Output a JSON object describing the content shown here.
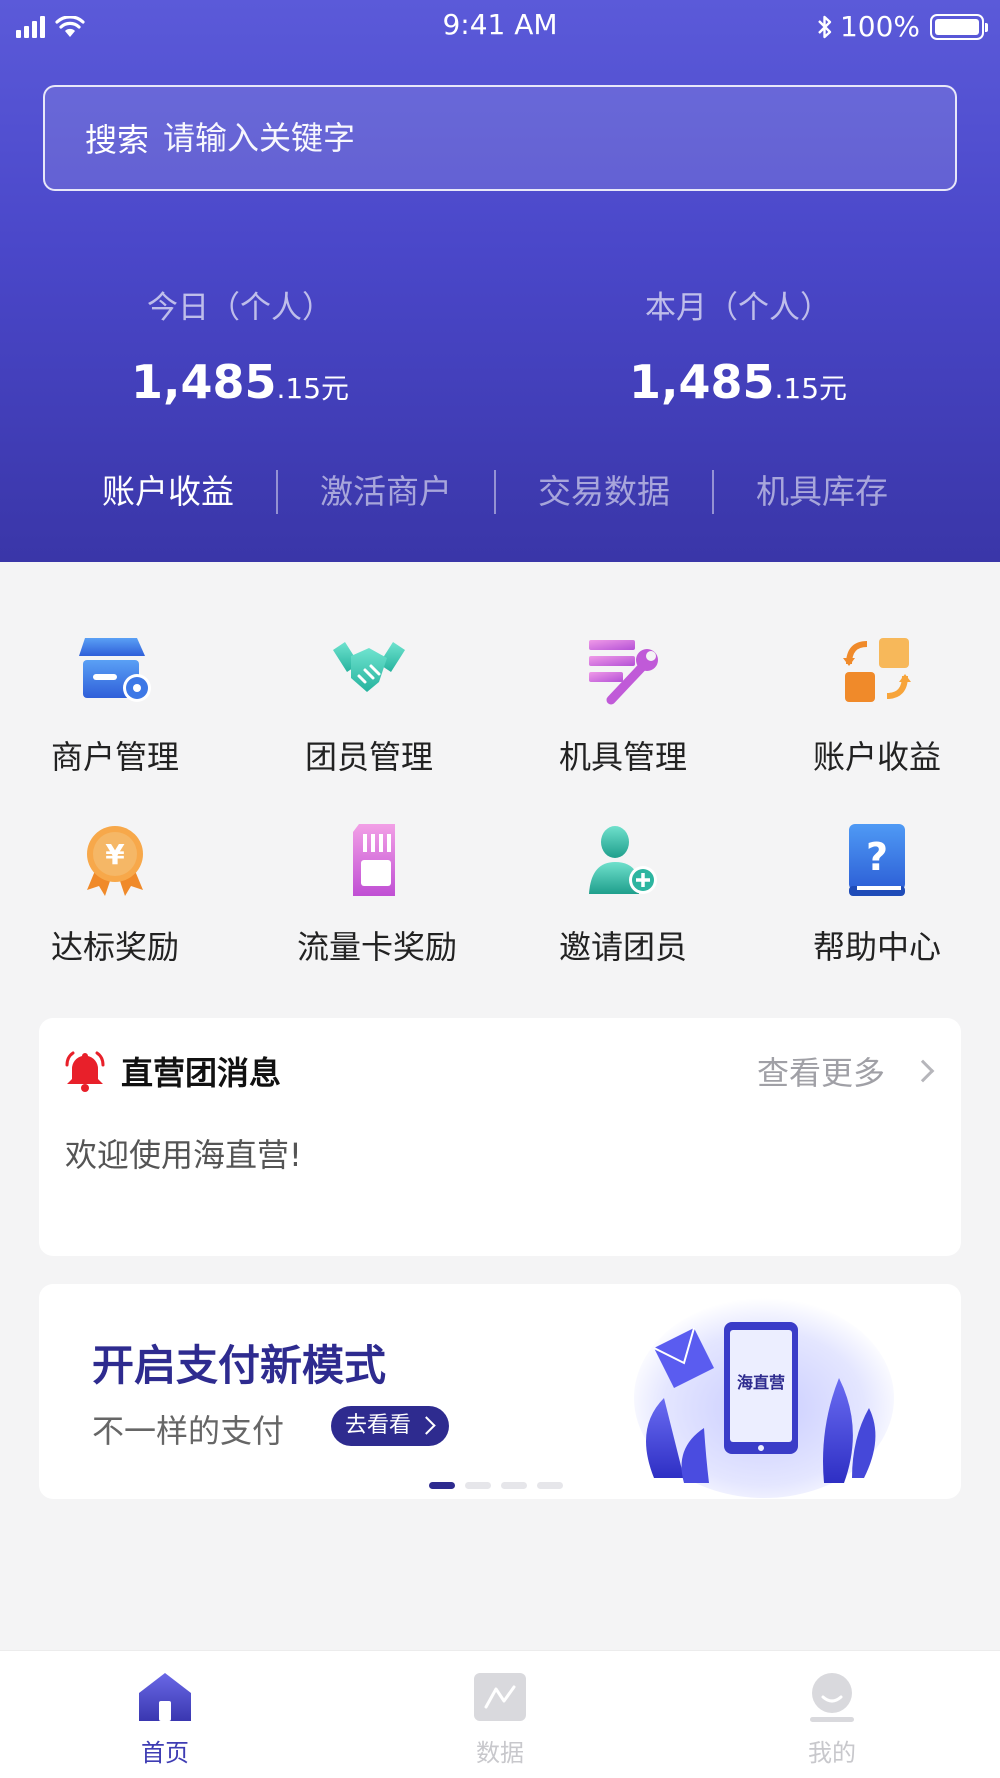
{
  "status_bar": {
    "time": "9:41 AM",
    "battery": "100%"
  },
  "search": {
    "label": "搜索",
    "placeholder": "请输入关键字"
  },
  "stats": [
    {
      "label": "今日（个人）",
      "value_main": "1,485",
      "value_fraction": ".15元"
    },
    {
      "label": "本月（个人）",
      "value_main": "1,485",
      "value_fraction": ".15元"
    }
  ],
  "tabs": [
    "账户收益",
    "激活商户",
    "交易数据",
    "机具库存"
  ],
  "menu": [
    {
      "label": "商户管理",
      "icon": "store-settings-icon"
    },
    {
      "label": "团员管理",
      "icon": "handshake-icon"
    },
    {
      "label": "机具管理",
      "icon": "tools-list-icon"
    },
    {
      "label": "账户收益",
      "icon": "exchange-icon"
    },
    {
      "label": "达标奖励",
      "icon": "medal-icon"
    },
    {
      "label": "流量卡奖励",
      "icon": "sim-card-icon"
    },
    {
      "label": "邀请团员",
      "icon": "add-user-icon"
    },
    {
      "label": "帮助中心",
      "icon": "help-book-icon"
    }
  ],
  "message": {
    "title": "直营团消息",
    "more": "查看更多",
    "body": "欢迎使用海直营!"
  },
  "banner": {
    "title": "开启支付新模式",
    "subtitle": "不一样的支付",
    "button": "去看看",
    "phone_text": "海直营",
    "slide_count": 4,
    "active_slide": 1
  },
  "bottom_nav": [
    {
      "label": "首页",
      "icon": "home-icon",
      "active": true
    },
    {
      "label": "数据",
      "icon": "chart-icon",
      "active": false
    },
    {
      "label": "我的",
      "icon": "profile-icon",
      "active": false
    }
  ],
  "colors": {
    "header_top": "#5b5ad9",
    "header_bottom": "#3a36a8",
    "accent": "#2e2b8f",
    "nav_active": "#3e3cb3",
    "bell": "#e8202a"
  }
}
